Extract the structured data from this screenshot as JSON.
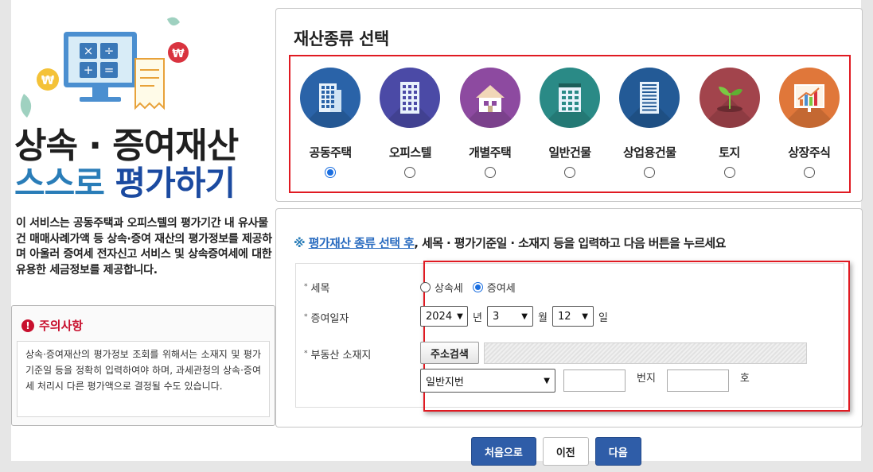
{
  "hero": {
    "title_line1": "상속 · 증여재산",
    "title_line2_a": "스스로",
    "title_line2_b": "평가하기"
  },
  "intro": "이 서비스는 공동주택과 오피스텔의 평가기간 내 유사물건 매매사례가액 등 상속·증여 재산의 평가정보를 제공하며 아울러 증여세 전자신고 서비스 및 상속증여세에 대한 유용한 세금정보를 제공합니다.",
  "notice": {
    "title": "주의사항",
    "body": "상속·증여재산의 평가정보 조회를 위해서는 소재지 및 평가기준일 등을 정확히 입력하여야 하며, 과세관청의 상속·증여세 처리시 다른 평가액으로 결정될 수도 있습니다."
  },
  "property_select": {
    "title": "재산종류 선택",
    "types": [
      {
        "label": "공동주택",
        "icon": "apartment-icon",
        "color": "#2a63a8",
        "selected": true
      },
      {
        "label": "오피스텔",
        "icon": "officetel-icon",
        "color": "#4b4aa6",
        "selected": false
      },
      {
        "label": "개별주택",
        "icon": "house-icon",
        "color": "#8d4aa0",
        "selected": false
      },
      {
        "label": "일반건물",
        "icon": "building-icon",
        "color": "#2a8a86",
        "selected": false
      },
      {
        "label": "상업용건물",
        "icon": "commercial-building-icon",
        "color": "#235a96",
        "selected": false
      },
      {
        "label": "토지",
        "icon": "land-sprout-icon",
        "color": "#a2444c",
        "selected": false
      },
      {
        "label": "상장주식",
        "icon": "stock-chart-icon",
        "color": "#e0773a",
        "selected": false
      }
    ]
  },
  "guide": {
    "mark": "※",
    "link": "평가재산 종류 선택 후",
    "rest": ", 세목 · 평가기준일 · 소재지 등을 입력하고 다음 버튼을 누르세요"
  },
  "form": {
    "tax_label": "세목",
    "tax_options": [
      "상속세",
      "증여세"
    ],
    "tax_selected": "증여세",
    "date_label": "증여일자",
    "year": "2024",
    "year_unit": "년",
    "month": "3",
    "month_unit": "월",
    "day": "12",
    "day_unit": "일",
    "address_label": "부동산 소재지",
    "address_button": "주소검색",
    "lot_type": "일반지번",
    "lot_unit": "번지",
    "ho_unit": "호"
  },
  "buttons": {
    "first": "처음으로",
    "prev": "이전",
    "next": "다음"
  }
}
